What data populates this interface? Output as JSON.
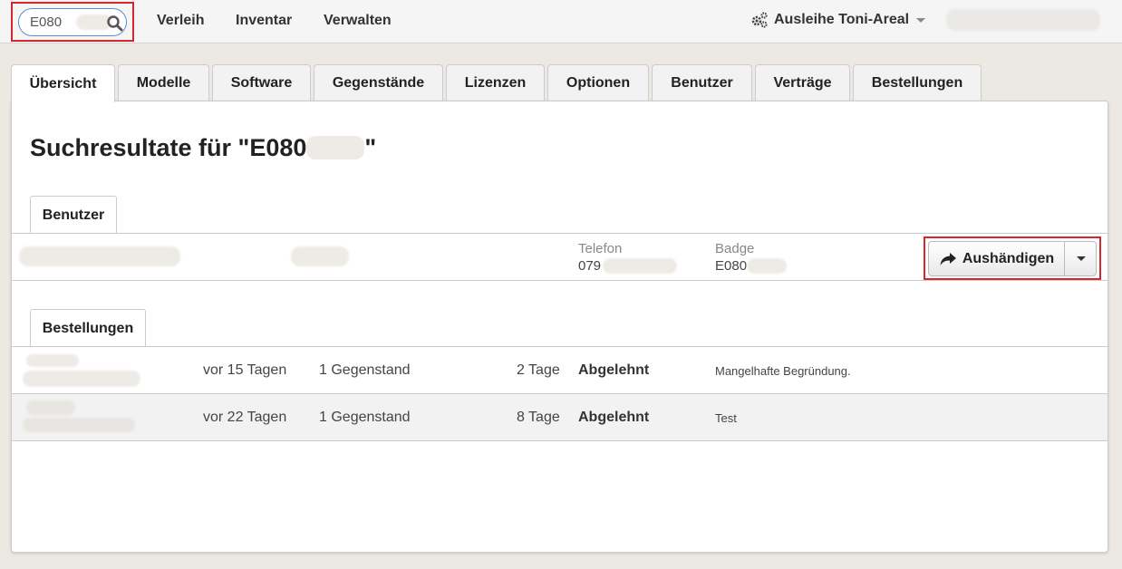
{
  "search": {
    "value": "E080"
  },
  "nav": {
    "items": [
      "Verleih",
      "Inventar",
      "Verwalten"
    ]
  },
  "org_menu": {
    "label": "Ausleihe Toni-Areal"
  },
  "tabs": [
    "Übersicht",
    "Modelle",
    "Software",
    "Gegenstände",
    "Lizenzen",
    "Optionen",
    "Benutzer",
    "Verträge",
    "Bestellungen"
  ],
  "page": {
    "title": "Suchresultate für \"E080",
    "title_end": "\""
  },
  "users_section": {
    "title": "Benutzer",
    "phone_label": "Telefon",
    "phone_value": "079",
    "badge_label": "Badge",
    "badge_value": "E080",
    "action_label": "Aushändigen"
  },
  "orders_section": {
    "title": "Bestellungen",
    "rows": [
      {
        "created": "vor 15 Tagen",
        "items": "1 Gegenstand",
        "duration": "2 Tage",
        "status": "Abgelehnt",
        "reason": "Mangelhafte Begründung."
      },
      {
        "created": "vor 22 Tagen",
        "items": "1 Gegenstand",
        "duration": "8 Tage",
        "status": "Abgelehnt",
        "reason": "Test"
      }
    ]
  },
  "colors": {
    "highlight": "#d9262b",
    "search_border": "#5b8fd0"
  }
}
